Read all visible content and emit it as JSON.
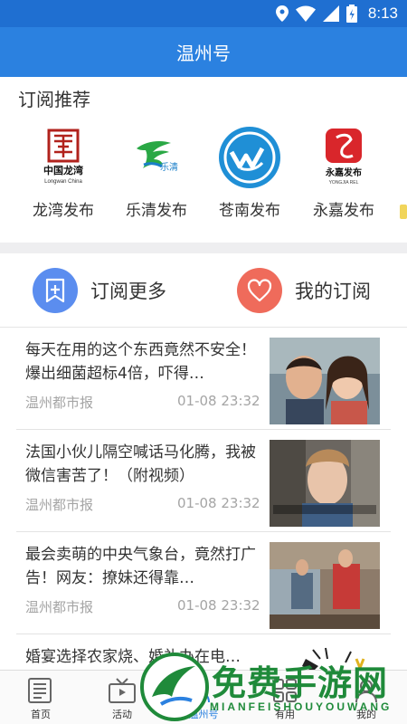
{
  "status_bar": {
    "time": "8:13"
  },
  "header": {
    "title": "温州号"
  },
  "recommend": {
    "title": "订阅推荐",
    "items": [
      {
        "label": "龙湾发布",
        "logo_text": "中国龙湾",
        "logo_sub": "Longwan China"
      },
      {
        "label": "乐清发布",
        "logo_text": "乐清"
      },
      {
        "label": "苍南发布"
      },
      {
        "label": "永嘉发布",
        "logo_text": "永嘉发布",
        "logo_sub": "YONGJIA REL"
      }
    ]
  },
  "actions": {
    "subscribe_more": "订阅更多",
    "my_subscriptions": "我的订阅"
  },
  "news": [
    {
      "title": "每天在用的这个东西竟然不安全！爆出细菌超标4倍，吓得…",
      "source": "温州都市报",
      "time": "01-08 23:32"
    },
    {
      "title": "法国小伙儿隔空喊话马化腾，我被微信害苦了！（附视频）",
      "source": "温州都市报",
      "time": "01-08 23:32"
    },
    {
      "title": "最会卖萌的中央气象台，竟然打广告！网友：撩妹还得靠…",
      "source": "温州都市报",
      "time": "01-08 23:32"
    },
    {
      "title": "婚宴选择农家烧、婚礼办在电…",
      "source": "",
      "time": ""
    }
  ],
  "bottom_nav": [
    {
      "label": "首页"
    },
    {
      "label": "活动"
    },
    {
      "label": "温州号"
    },
    {
      "label": "有用"
    },
    {
      "label": "我的"
    }
  ],
  "watermark": {
    "text": "免费手游网",
    "sub": "MIANFEISHOUYOUWANG"
  },
  "colors": {
    "primary": "#2b81e0",
    "status_bar": "#1f6fd1",
    "subscribe_icon": "#5b8def",
    "my_sub_icon": "#ef6b5b"
  }
}
